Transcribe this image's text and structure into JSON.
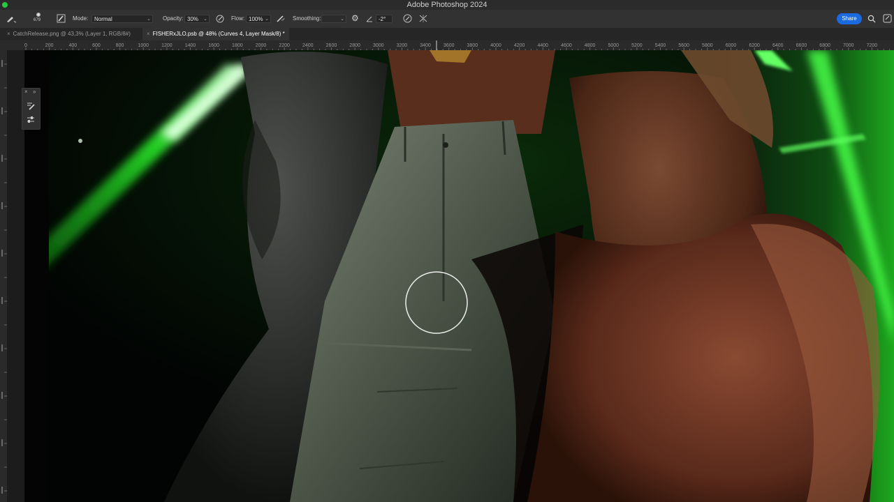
{
  "app": {
    "window_title": "Adobe Photoshop 2024"
  },
  "options_bar": {
    "brush_size": "679",
    "mode_label": "Mode:",
    "mode_value": "Normal",
    "opacity_label": "Opacity:",
    "opacity_value": "30%",
    "flow_label": "Flow:",
    "flow_value": "100%",
    "smoothing_label": "Smoothing:",
    "angle_value": "-2°",
    "share_label": "Share"
  },
  "tabs": [
    {
      "label": "CatchRelease.png @ 43,3% (Layer 1, RGB/8#)"
    },
    {
      "label": "FISHERxJLO.psb @ 48% (Curves 4, Layer Mask/8) *"
    }
  ],
  "ruler": {
    "labels": [
      "0",
      "200",
      "400",
      "600",
      "800",
      "1000",
      "1200",
      "1400",
      "1600",
      "1800",
      "2000",
      "2200",
      "2400",
      "2600",
      "2800",
      "3000",
      "3200",
      "3400",
      "3600",
      "3800",
      "4000",
      "4200",
      "4400",
      "4600",
      "4800",
      "5000",
      "5200",
      "5400",
      "5600",
      "5800",
      "6000",
      "6200",
      "6400",
      "6600",
      "6800",
      "7000",
      "7200"
    ]
  },
  "colors": {
    "accent": "#1b6ae0",
    "glow": "#3cff3c",
    "panel": "#323232"
  },
  "icons": [
    "brush-tool-icon",
    "brush-preset-icon",
    "airbrush-icon",
    "pressure-opacity-icon",
    "pressure-flow-icon",
    "gear-icon",
    "angle-icon",
    "pressure-size-icon",
    "symmetry-icon",
    "search-icon",
    "workspace-icon",
    "brush-settings-icon",
    "properties-icon"
  ]
}
